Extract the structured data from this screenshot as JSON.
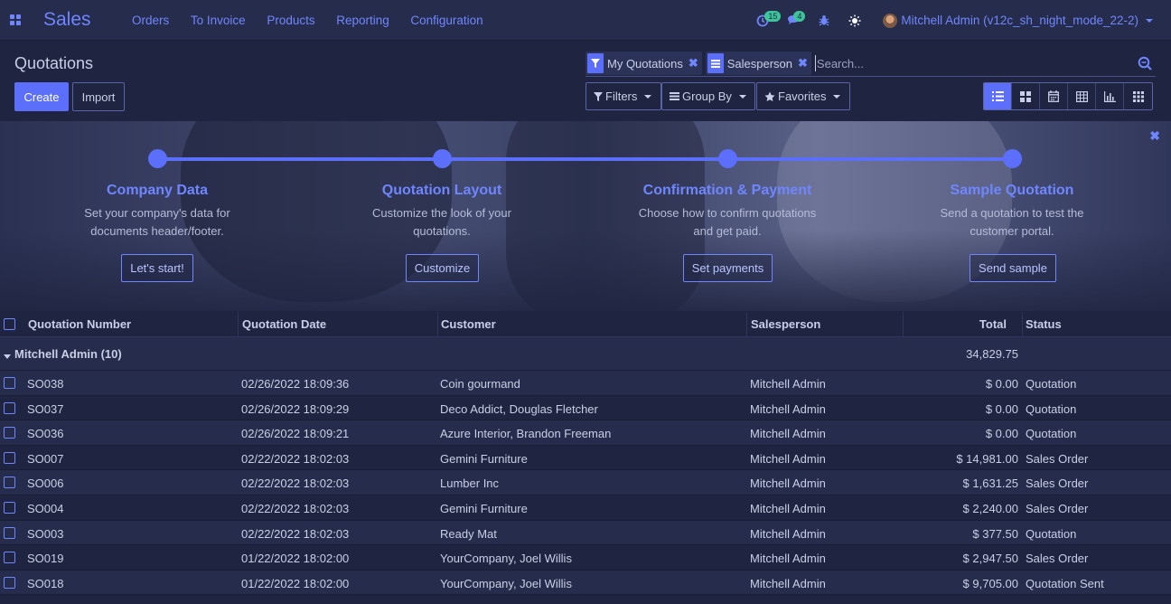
{
  "navbar": {
    "brand": "Sales",
    "menu": [
      "Orders",
      "To Invoice",
      "Products",
      "Reporting",
      "Configuration"
    ],
    "activity_count": "15",
    "message_count": "4",
    "user_name": "Mitchell Admin (v12c_sh_night_mode_22-2)"
  },
  "control_panel": {
    "title": "Quotations",
    "create_label": "Create",
    "import_label": "Import",
    "facets": [
      {
        "label": "My Quotations",
        "icon": "filter-icon"
      },
      {
        "label": "Salesperson",
        "icon": "group-by-icon"
      }
    ],
    "search_placeholder": "Search...",
    "filters_label": "Filters",
    "groupby_label": "Group By",
    "favorites_label": "Favorites"
  },
  "onboarding": {
    "steps": [
      {
        "title": "Company Data",
        "desc1": "Set your company's data for",
        "desc2": "documents header/footer.",
        "button": "Let's start!"
      },
      {
        "title": "Quotation Layout",
        "desc1": "Customize the look of your",
        "desc2": "quotations.",
        "button": "Customize"
      },
      {
        "title": "Confirmation & Payment",
        "desc1": "Choose how to confirm quotations",
        "desc2": "and get paid.",
        "button": "Set payments"
      },
      {
        "title": "Sample Quotation",
        "desc1": "Send a quotation to test the",
        "desc2": "customer portal.",
        "button": "Send sample"
      }
    ]
  },
  "list": {
    "columns": {
      "number": "Quotation Number",
      "date": "Quotation Date",
      "customer": "Customer",
      "salesperson": "Salesperson",
      "total": "Total",
      "status": "Status"
    },
    "group": {
      "label": "Mitchell Admin (10)",
      "total": "34,829.75"
    },
    "rows": [
      {
        "number": "SO038",
        "date": "02/26/2022 18:09:36",
        "customer": "Coin gourmand",
        "salesperson": "Mitchell Admin",
        "total": "$ 0.00",
        "status": "Quotation"
      },
      {
        "number": "SO037",
        "date": "02/26/2022 18:09:29",
        "customer": "Deco Addict, Douglas Fletcher",
        "salesperson": "Mitchell Admin",
        "total": "$ 0.00",
        "status": "Quotation"
      },
      {
        "number": "SO036",
        "date": "02/26/2022 18:09:21",
        "customer": "Azure Interior, Brandon Freeman",
        "salesperson": "Mitchell Admin",
        "total": "$ 0.00",
        "status": "Quotation"
      },
      {
        "number": "SO007",
        "date": "02/22/2022 18:02:03",
        "customer": "Gemini Furniture",
        "salesperson": "Mitchell Admin",
        "total": "$ 14,981.00",
        "status": "Sales Order"
      },
      {
        "number": "SO006",
        "date": "02/22/2022 18:02:03",
        "customer": "Lumber Inc",
        "salesperson": "Mitchell Admin",
        "total": "$ 1,631.25",
        "status": "Sales Order"
      },
      {
        "number": "SO004",
        "date": "02/22/2022 18:02:03",
        "customer": "Gemini Furniture",
        "salesperson": "Mitchell Admin",
        "total": "$ 2,240.00",
        "status": "Sales Order"
      },
      {
        "number": "SO003",
        "date": "02/22/2022 18:02:03",
        "customer": "Ready Mat",
        "salesperson": "Mitchell Admin",
        "total": "$ 377.50",
        "status": "Quotation"
      },
      {
        "number": "SO019",
        "date": "01/22/2022 18:02:00",
        "customer": "YourCompany, Joel Willis",
        "salesperson": "Mitchell Admin",
        "total": "$ 2,947.50",
        "status": "Sales Order"
      },
      {
        "number": "SO018",
        "date": "01/22/2022 18:02:00",
        "customer": "YourCompany, Joel Willis",
        "salesperson": "Mitchell Admin",
        "total": "$ 9,705.00",
        "status": "Quotation Sent"
      }
    ]
  }
}
